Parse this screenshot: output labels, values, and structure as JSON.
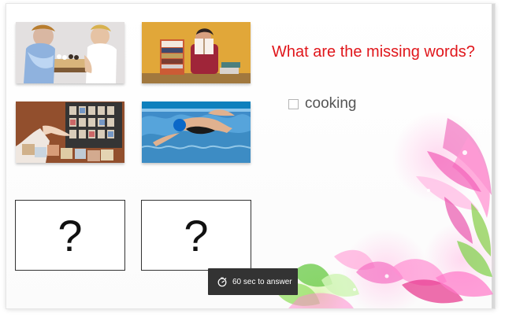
{
  "question": {
    "text": "What are the missing words?"
  },
  "options": [
    {
      "label": "cooking",
      "checked": false
    }
  ],
  "unknown_tiles": [
    {
      "text": "?"
    },
    {
      "text": "?"
    }
  ],
  "timer": {
    "icon": "stopwatch-icon",
    "text": "60 sec to answer"
  },
  "colors": {
    "question": "#e0161b",
    "timer_bg": "#333333"
  }
}
